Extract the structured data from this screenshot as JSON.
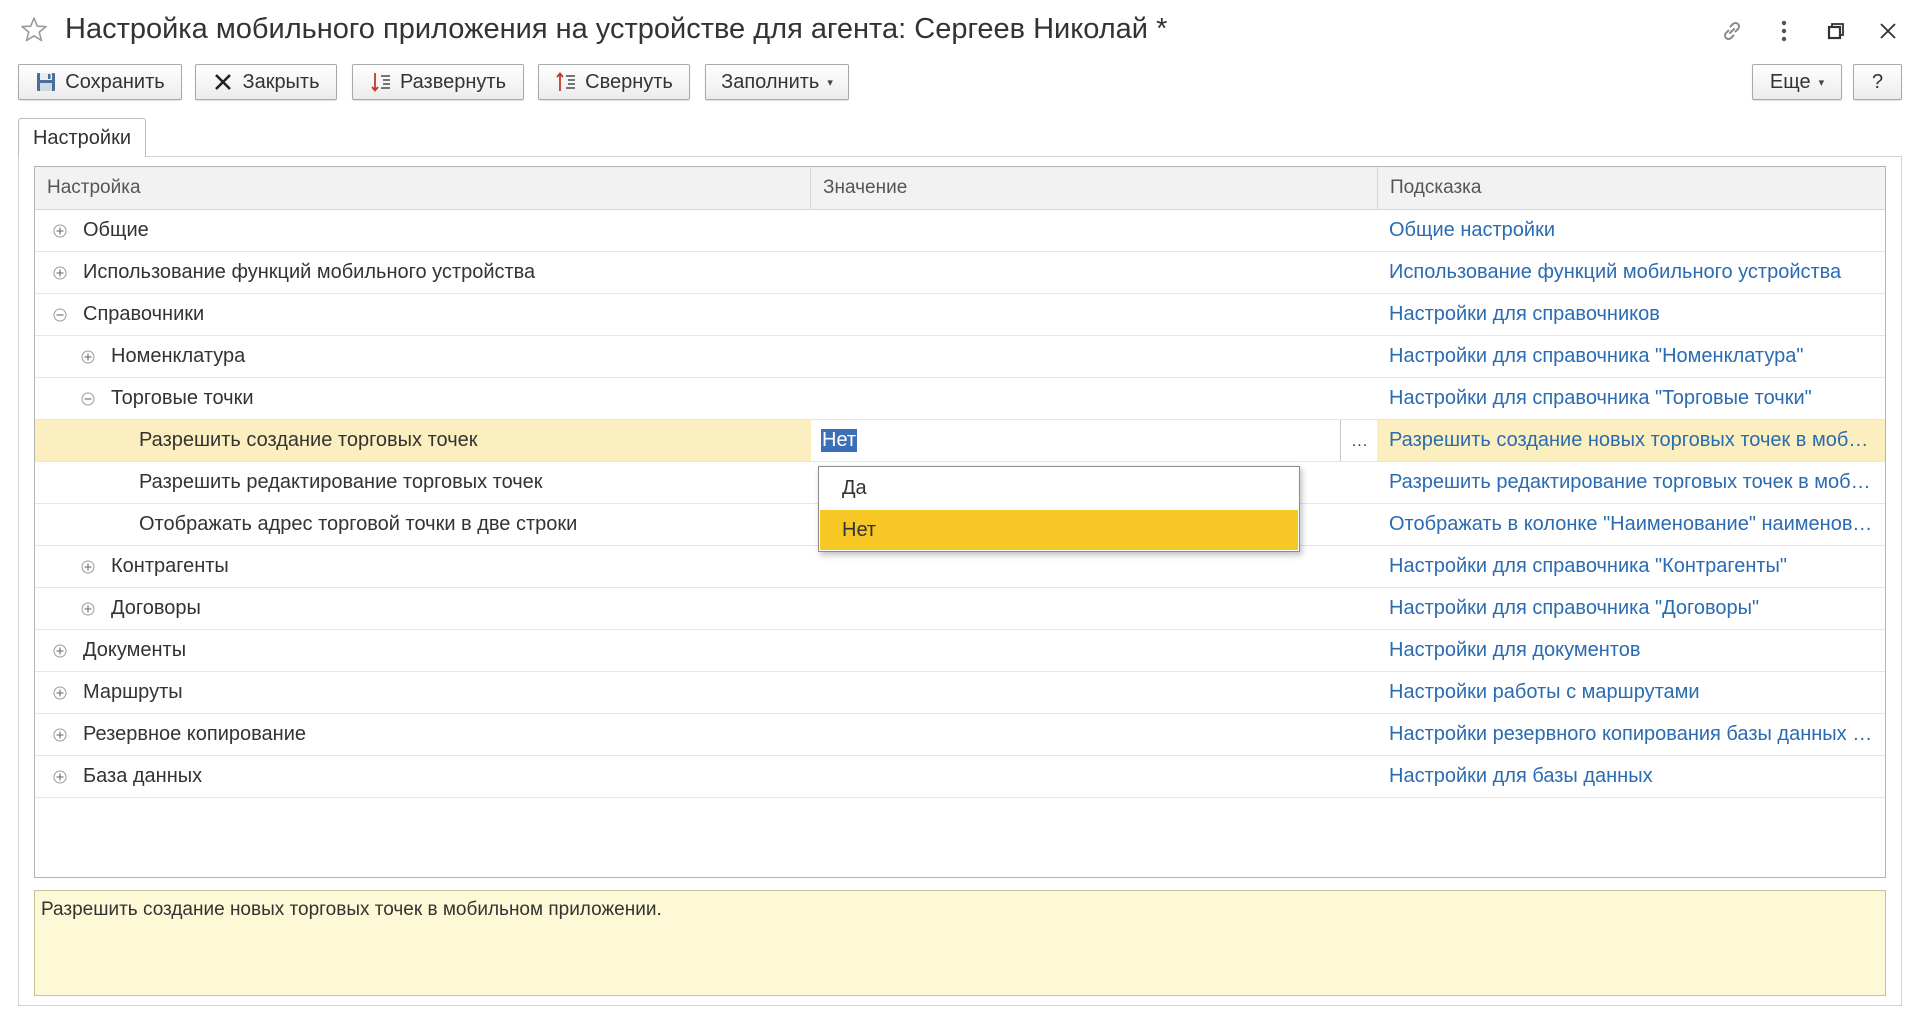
{
  "window": {
    "title": "Настройка мобильного приложения на устройстве для агента: Сергеев Николай *"
  },
  "toolbar": {
    "save": "Сохранить",
    "close": "Закрыть",
    "expand": "Развернуть",
    "collapse": "Свернуть",
    "fill": "Заполнить",
    "more": "Еще",
    "help": "?"
  },
  "tabs": [
    {
      "label": "Настройки",
      "active": true
    }
  ],
  "grid": {
    "columns": {
      "setting": "Настройка",
      "value": "Значение",
      "hint": "Подсказка"
    },
    "rows": [
      {
        "name": "Общие",
        "level": 0,
        "toggle": "plus",
        "hint": "Общие настройки"
      },
      {
        "name": "Использование функций мобильного устройства",
        "level": 0,
        "toggle": "plus",
        "hint": "Использование функций мобильного устройства"
      },
      {
        "name": "Справочники",
        "level": 0,
        "toggle": "minus",
        "hint": "Настройки для справочников"
      },
      {
        "name": "Номенклатура",
        "level": 1,
        "toggle": "plus",
        "hint": "Настройки для справочника \"Номенклатура\""
      },
      {
        "name": "Торговые точки",
        "level": 1,
        "toggle": "minus",
        "hint": "Настройки для справочника \"Торговые точки\""
      },
      {
        "name": "Разрешить создание торговых точек",
        "level": 2,
        "toggle": "none",
        "hint": "Разрешить создание новых торговых точек в мобильном приложении",
        "selected": true
      },
      {
        "name": "Разрешить редактирование торговых точек",
        "level": 2,
        "toggle": "none",
        "hint": "Разрешить редактирование торговых точек в мобильном приложении"
      },
      {
        "name": "Отображать адрес торговой точки в две строки",
        "level": 2,
        "toggle": "none",
        "hint": "Отображать в колонке \"Наименование\" наименование и адрес"
      },
      {
        "name": "Контрагенты",
        "level": 1,
        "toggle": "plus",
        "hint": "Настройки для справочника \"Контрагенты\""
      },
      {
        "name": "Договоры",
        "level": 1,
        "toggle": "plus",
        "hint": "Настройки для справочника \"Договоры\""
      },
      {
        "name": "Документы",
        "level": 0,
        "toggle": "plus",
        "hint": "Настройки для документов"
      },
      {
        "name": "Маршруты",
        "level": 0,
        "toggle": "plus",
        "hint": "Настройки работы с маршрутами"
      },
      {
        "name": "Резервное копирование",
        "level": 0,
        "toggle": "plus",
        "hint": "Настройки резервного копирования базы данных мобильного приложения"
      },
      {
        "name": "База данных",
        "level": 0,
        "toggle": "plus",
        "hint": "Настройки для базы данных"
      }
    ]
  },
  "editor": {
    "value": "Нет",
    "choice_button": "..."
  },
  "dropdown": {
    "options": [
      {
        "label": "Да",
        "active": false
      },
      {
        "label": "Нет",
        "active": true
      }
    ]
  },
  "hint_panel": {
    "text": "Разрешить создание новых торговых точек в мобильном приложении."
  },
  "colors": {
    "hint_link": "#2a6bb1",
    "selected_row": "#fbefc0",
    "active_option": "#f7c726",
    "hint_panel_bg": "#fdf8d5"
  }
}
